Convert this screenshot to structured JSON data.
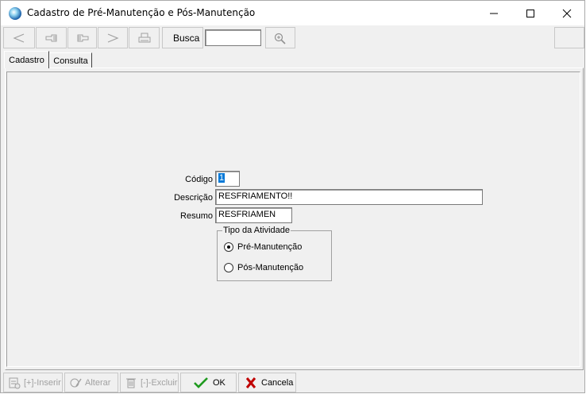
{
  "window": {
    "title": "Cadastro de Pré-Manutenção e Pós-Manutenção",
    "controls": [
      "minimize-icon",
      "maximize-icon",
      "close-icon"
    ]
  },
  "toolbar": {
    "buttons": [
      {
        "name": "first-record-button",
        "icon": "arrow-left-icon"
      },
      {
        "name": "previous-record-button",
        "icon": "hand-point-left-icon"
      },
      {
        "name": "next-record-button",
        "icon": "hand-point-right-icon"
      },
      {
        "name": "last-record-button",
        "icon": "arrow-right-icon"
      },
      {
        "name": "print-button",
        "icon": "printer-icon"
      }
    ],
    "search_label": "Busca",
    "search_value": "",
    "search_button_icon": "magnifier-icon"
  },
  "tabs": [
    {
      "label": "Cadastro",
      "active": true
    },
    {
      "label": "Consulta",
      "active": false
    }
  ],
  "form": {
    "codigo_label": "Código",
    "codigo_value": "1",
    "descricao_label": "Descrição",
    "descricao_value": "RESFRIAMENTO!!",
    "resumo_label": "Resumo",
    "resumo_value": "RESFRIAMEN",
    "tipo_group_label": "Tipo da Atividade",
    "tipo_options": [
      {
        "label": "Pré-Manutenção",
        "selected": true
      },
      {
        "label": "Pós-Manutenção",
        "selected": false
      }
    ]
  },
  "actions": {
    "inserir_label": "[+]-Inserir",
    "alterar_label": "Alterar",
    "excluir_label": "[-]-Excluir",
    "ok_label": "OK",
    "cancelar_label": "Cancela"
  },
  "colors": {
    "ok_check": "#1f9a1f",
    "cancel_x": "#c00000",
    "selection": "#0078d7"
  }
}
